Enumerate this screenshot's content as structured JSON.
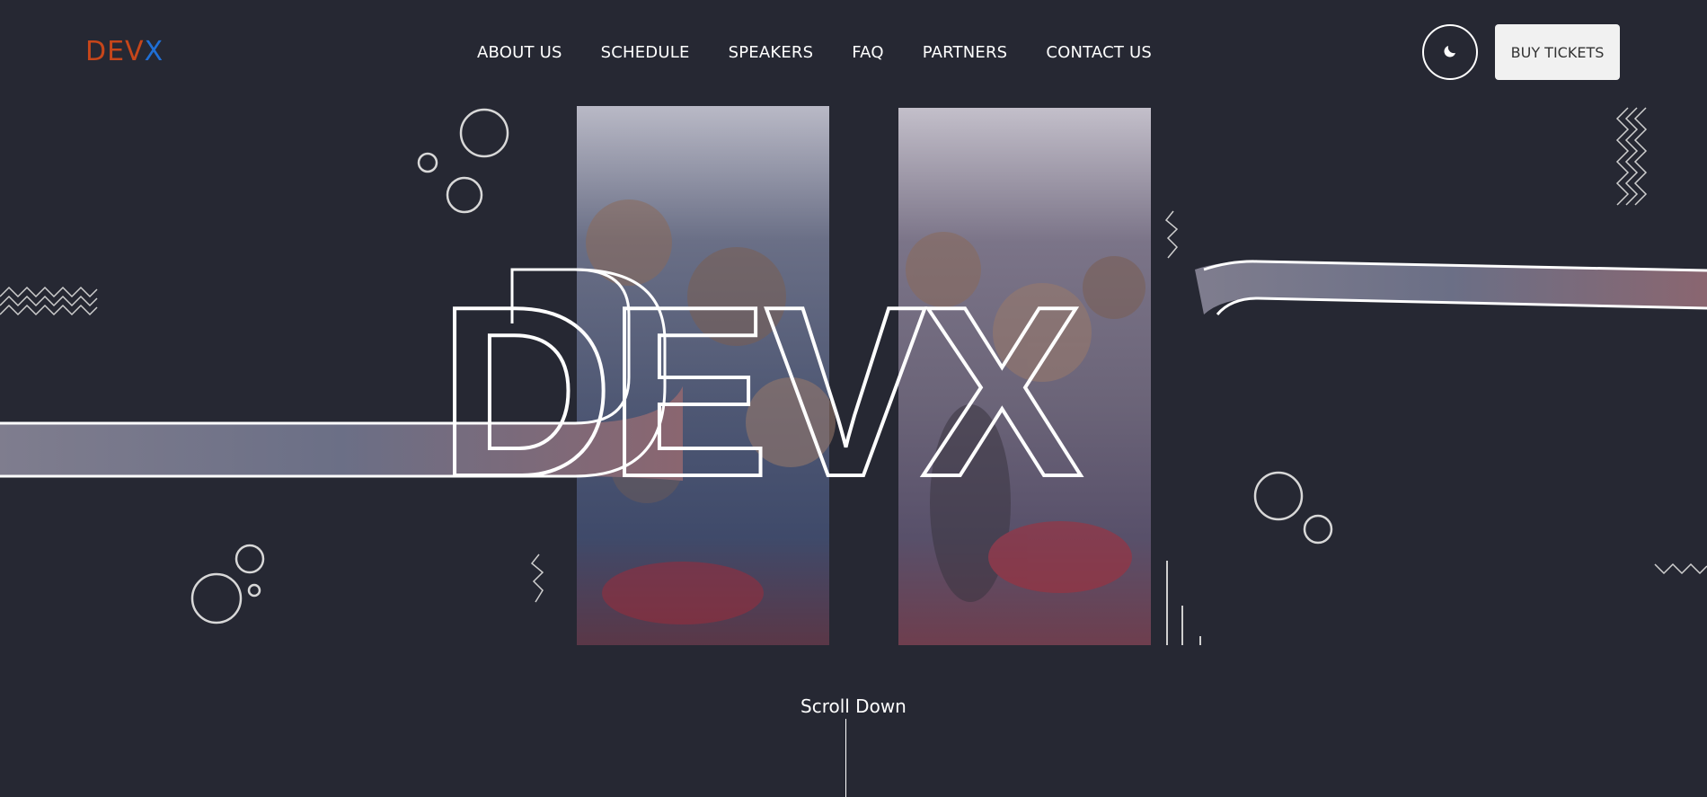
{
  "brand": {
    "logo_part_a": "DEV",
    "logo_part_b": "X",
    "accent_orange": "#c7461a",
    "accent_blue": "#1f6fd6"
  },
  "nav": {
    "items": [
      "ABOUT US",
      "SCHEDULE",
      "SPEAKERS",
      "FAQ",
      "PARTNERS",
      "CONTACT US"
    ]
  },
  "header": {
    "theme_toggle_icon": "moon-icon",
    "buy_label": "BUY TICKETS"
  },
  "hero": {
    "title": "DEVX",
    "background": "#262833",
    "photo_description_icon": "crowd-photo"
  },
  "scroll": {
    "label": "Scroll Down"
  }
}
